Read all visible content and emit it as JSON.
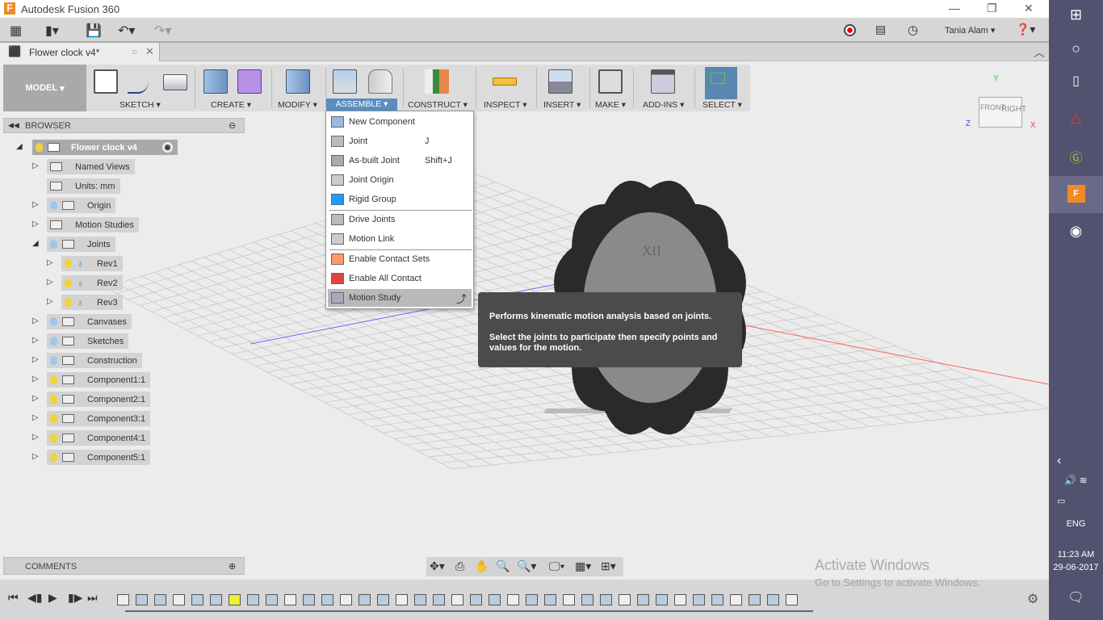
{
  "app": {
    "title": "Autodesk Fusion 360",
    "logo": "F"
  },
  "topbar": {
    "user": "Tania Alam",
    "icons": [
      "apps-grid-icon",
      "file-icon",
      "save-icon",
      "undo-icon",
      "redo-icon",
      "record-icon",
      "comment-icon",
      "clock-icon",
      "help-icon"
    ]
  },
  "doc_tab": {
    "title": "Flower clock v4*"
  },
  "ribbon": {
    "workspace": "MODEL",
    "groups": [
      "SKETCH",
      "CREATE",
      "MODIFY",
      "ASSEMBLE",
      "CONSTRUCT",
      "INSPECT",
      "INSERT",
      "MAKE",
      "ADD-INS",
      "SELECT"
    ],
    "active": "ASSEMBLE",
    "accent": "#5a8ec1"
  },
  "browser": {
    "title": "BROWSER",
    "root": "Flower clock v4",
    "items": [
      {
        "label": "Named Views",
        "level": 1,
        "bulb": "none"
      },
      {
        "label": "Units: mm",
        "level": 1,
        "bulb": "none",
        "notri": true
      },
      {
        "label": "Origin",
        "level": 1,
        "bulb": "blue"
      },
      {
        "label": "Motion Studies",
        "level": 1,
        "bulb": "none"
      },
      {
        "label": "Joints",
        "level": 1,
        "bulb": "blue",
        "open": true
      },
      {
        "label": "Rev1",
        "level": 2,
        "bulb": "yellow"
      },
      {
        "label": "Rev2",
        "level": 2,
        "bulb": "yellow"
      },
      {
        "label": "Rev3",
        "level": 2,
        "bulb": "yellow"
      },
      {
        "label": "Canvases",
        "level": 1,
        "bulb": "blue"
      },
      {
        "label": "Sketches",
        "level": 1,
        "bulb": "blue"
      },
      {
        "label": "Construction",
        "level": 1,
        "bulb": "blue"
      },
      {
        "label": "Component1:1",
        "level": 1,
        "bulb": "yellow"
      },
      {
        "label": "Component2:1",
        "level": 1,
        "bulb": "yellow"
      },
      {
        "label": "Component3:1",
        "level": 1,
        "bulb": "yellow"
      },
      {
        "label": "Component4:1",
        "level": 1,
        "bulb": "yellow"
      },
      {
        "label": "Component5:1",
        "level": 1,
        "bulb": "yellow"
      }
    ]
  },
  "assemble_menu": [
    {
      "label": "New Component",
      "shortcut": ""
    },
    {
      "label": "Joint",
      "shortcut": "J"
    },
    {
      "label": "As-built Joint",
      "shortcut": "Shift+J"
    },
    {
      "label": "Joint Origin",
      "shortcut": ""
    },
    {
      "label": "Rigid Group",
      "shortcut": "",
      "sep": true
    },
    {
      "label": "Drive Joints",
      "shortcut": ""
    },
    {
      "label": "Motion Link",
      "shortcut": "",
      "sep": true
    },
    {
      "label": "Enable Contact Sets",
      "shortcut": ""
    },
    {
      "label": "Enable All Contact",
      "shortcut": ""
    },
    {
      "label": "Motion Study",
      "shortcut": "",
      "hover": true
    }
  ],
  "tooltip": {
    "line1": "Performs kinematic motion analysis based on joints.",
    "line2": "Select the joints to participate then specify points and values for the motion."
  },
  "viewcube": {
    "front": "FRONT",
    "right": "RIGHT",
    "x": "X",
    "y": "Y",
    "z": "Z"
  },
  "clock": {
    "numeral": "XII"
  },
  "comments": {
    "title": "COMMENTS"
  },
  "watermark": {
    "line1": "Activate Windows",
    "line2": "Go to Settings to activate Windows."
  },
  "taskbar": {
    "time": "11:23 AM",
    "date": "29-06-2017",
    "lang": "ENG"
  }
}
